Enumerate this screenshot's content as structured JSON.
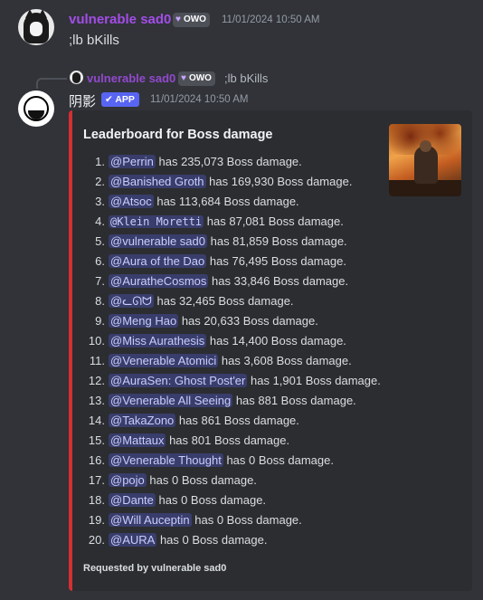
{
  "message1": {
    "username": "vulnerable sad0",
    "tag": "OWO",
    "timestamp": "11/01/2024 10:50 AM",
    "content": ";lb bKills"
  },
  "reply": {
    "username": "vulnerable sad0",
    "tag": "OWO",
    "content": ";lb bKills"
  },
  "message2": {
    "username": "阴影",
    "app_badge": "APP",
    "app_badge_check": "✔",
    "timestamp": "11/01/2024 10:50 AM"
  },
  "embed": {
    "accent_color": "#d42f31",
    "title": "Leaderboard for Boss damage",
    "entries": [
      {
        "rank": "1.",
        "user": "@Perrin",
        "text": "has 235,073 Boss damage."
      },
      {
        "rank": "2.",
        "user": "@Banished Groth",
        "text": "has 169,930 Boss damage."
      },
      {
        "rank": "3.",
        "user": "@Atsoc",
        "text": "has 113,684 Boss damage."
      },
      {
        "rank": "4.",
        "user": "@Klein Moretti",
        "text": "has 87,081 Boss damage."
      },
      {
        "rank": "5.",
        "user": "@vulnerable sad0",
        "text": "has 81,859 Boss damage."
      },
      {
        "rank": "6.",
        "user": "@Aura of the Dao",
        "text": "has 76,495 Boss damage."
      },
      {
        "rank": "7.",
        "user": "@AuratheCosmos",
        "text": "has 33,846 Boss damage."
      },
      {
        "rank": "8.",
        "user": "@ᓚᘏᗢ",
        "text": "has 32,465 Boss damage."
      },
      {
        "rank": "9.",
        "user": "@Meng Hao",
        "text": "has 20,633 Boss damage."
      },
      {
        "rank": "10.",
        "user": "@Miss Aurathesis",
        "text": "has 14,400 Boss damage."
      },
      {
        "rank": "11.",
        "user": "@Venerable Atomici",
        "text": "has 3,608 Boss damage."
      },
      {
        "rank": "12.",
        "user": "@AuraSen: Ghost Post'er",
        "text": "has 1,901 Boss damage."
      },
      {
        "rank": "13.",
        "user": "@Venerable All Seeing",
        "text": "has 881 Boss damage."
      },
      {
        "rank": "14.",
        "user": "@TakaZono",
        "text": "has 861 Boss damage."
      },
      {
        "rank": "15.",
        "user": "@Mattaux",
        "text": "has 801 Boss damage."
      },
      {
        "rank": "16.",
        "user": "@Venerable Thought",
        "text": "has 0 Boss damage."
      },
      {
        "rank": "17.",
        "user": "@pojo",
        "text": "has 0 Boss damage."
      },
      {
        "rank": "18.",
        "user": "@Dante",
        "text": "has 0 Boss damage."
      },
      {
        "rank": "19.",
        "user": "@Will Auceptin",
        "text": "has 0 Boss damage."
      },
      {
        "rank": "20.",
        "user": "@AURA",
        "text": "has 0 Boss damage."
      }
    ],
    "footer": "Requested by vulnerable sad0"
  }
}
